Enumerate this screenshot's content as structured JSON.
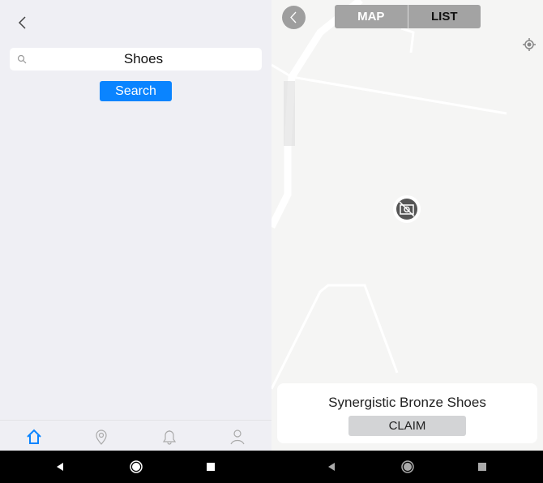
{
  "search": {
    "value": "Shoes",
    "button": "Search"
  },
  "tabs": [
    "home",
    "places",
    "notifications",
    "profile"
  ],
  "colors": {
    "accent": "#0a84ff"
  },
  "map": {
    "toggle": {
      "map": "MAP",
      "list": "LIST"
    },
    "card": {
      "title": "Synergistic Bronze Shoes",
      "button": "CLAIM"
    }
  }
}
